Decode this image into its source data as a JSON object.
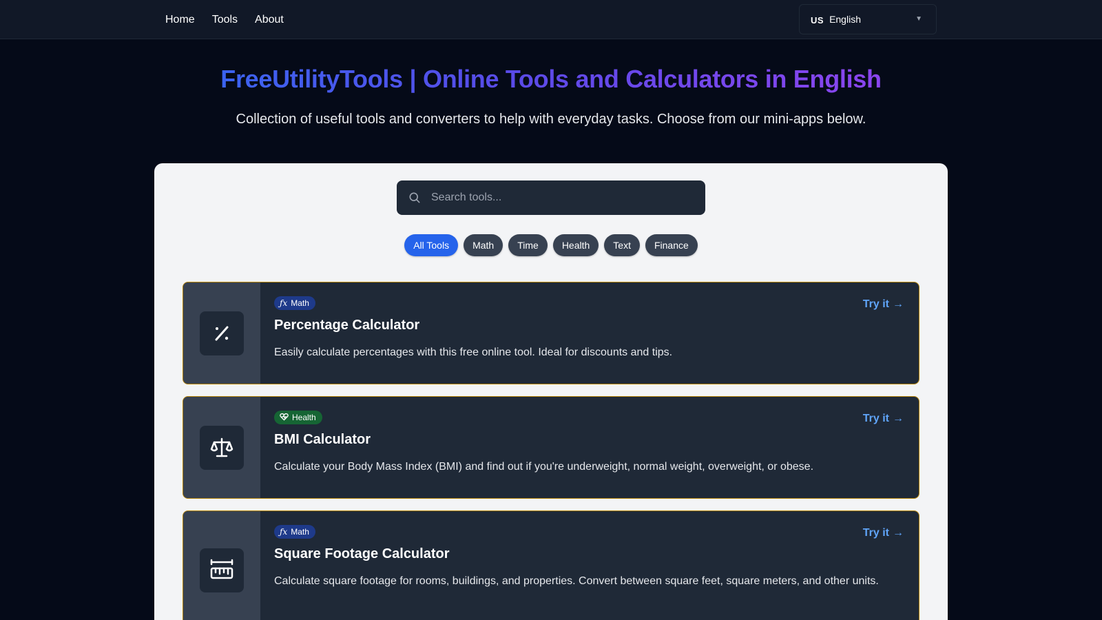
{
  "nav": {
    "links": [
      "Home",
      "Tools",
      "About"
    ],
    "language": {
      "flag": "US",
      "label": "English"
    }
  },
  "hero": {
    "title": "FreeUtilityTools | Online Tools and Calculators in English",
    "subtitle": "Collection of useful tools and converters to help with everyday tasks. Choose from our mini-apps below."
  },
  "search": {
    "placeholder": "Search tools...",
    "value": ""
  },
  "filters": [
    {
      "label": "All Tools",
      "active": true
    },
    {
      "label": "Math",
      "active": false
    },
    {
      "label": "Time",
      "active": false
    },
    {
      "label": "Health",
      "active": false
    },
    {
      "label": "Text",
      "active": false
    },
    {
      "label": "Finance",
      "active": false
    }
  ],
  "tools": [
    {
      "icon": "percent-icon",
      "category": "Math",
      "category_icon": "function-icon",
      "title": "Percentage Calculator",
      "description": "Easily calculate percentages with this free online tool. Ideal for discounts and tips.",
      "cta": "Try it"
    },
    {
      "icon": "scale-icon",
      "category": "Health",
      "category_icon": "heart-pulse-icon",
      "title": "BMI Calculator",
      "description": "Calculate your Body Mass Index (BMI) and find out if you're underweight, normal weight, overweight, or obese.",
      "cta": "Try it"
    },
    {
      "icon": "ruler-icon",
      "category": "Math",
      "category_icon": "function-icon",
      "title": "Square Footage Calculator",
      "description": "Calculate square footage for rooms, buildings, and properties. Convert between square feet, square meters, and other units.",
      "cta": "Try it"
    }
  ],
  "colors": {
    "background": "#050a18",
    "navbar": "#111827",
    "panel": "#f3f4f6",
    "card": "#1f2937",
    "card_border": "#b8860b",
    "accent": "#2563eb",
    "link": "#60a5fa",
    "title_gradient": [
      "#3b63f0",
      "#8b45ef"
    ]
  }
}
